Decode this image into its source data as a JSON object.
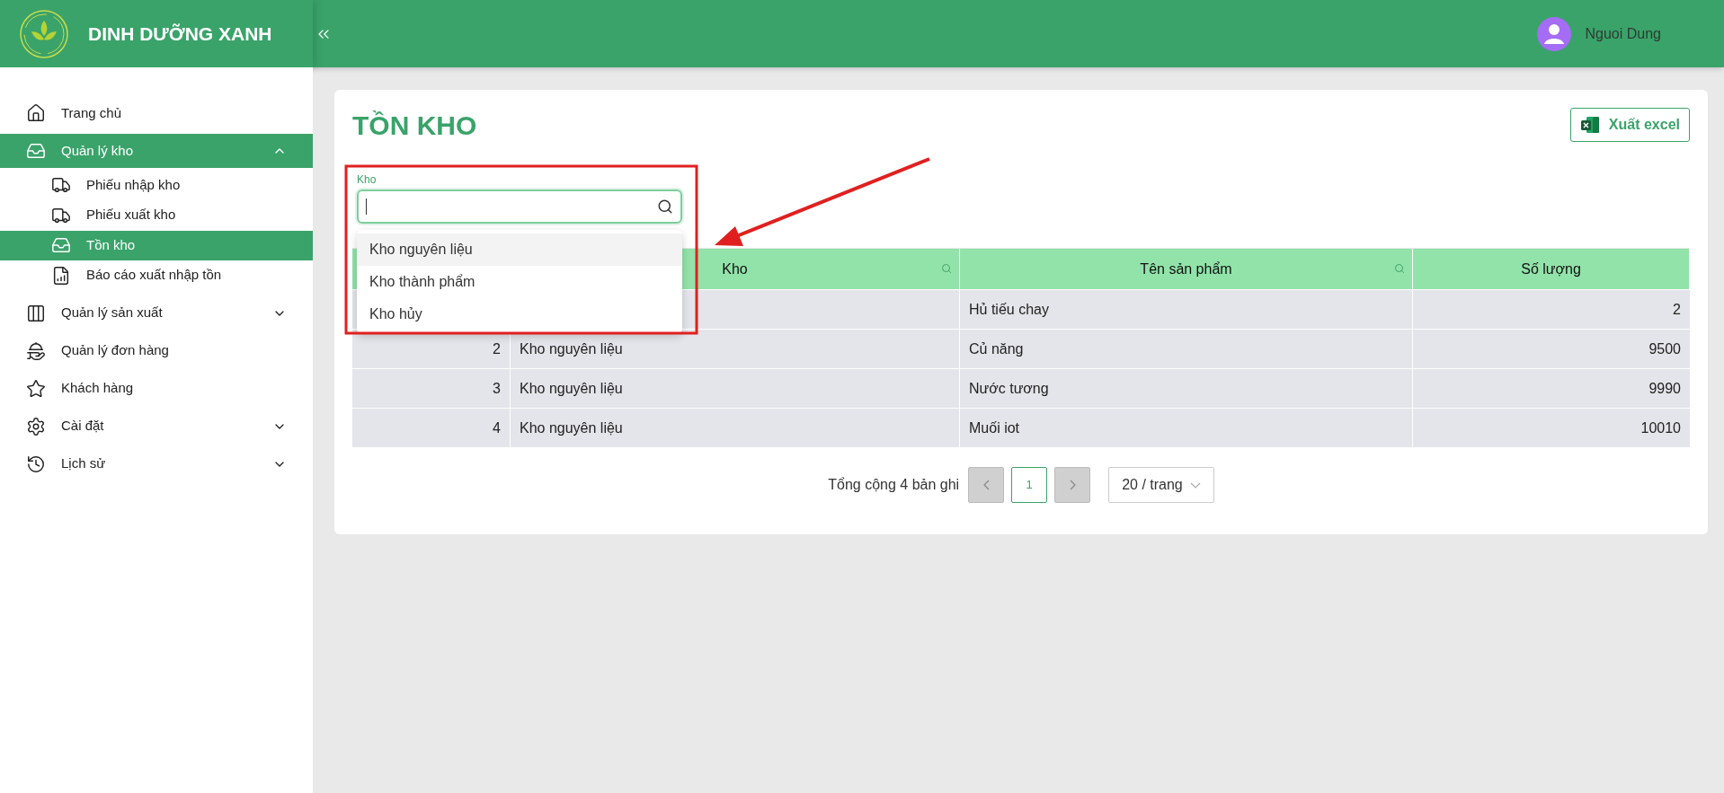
{
  "app": {
    "brand": "DINH DƯỠNG XANH"
  },
  "user": {
    "name": "Nguoi Dung"
  },
  "sidebar": {
    "items": [
      {
        "label": "Trang chủ",
        "selected": false
      },
      {
        "label": "Quản lý kho",
        "selected": true,
        "expanded": true,
        "children": [
          {
            "label": "Phiếu nhập kho",
            "selected": false
          },
          {
            "label": "Phiếu xuất kho",
            "selected": false
          },
          {
            "label": "Tồn kho",
            "selected": true
          },
          {
            "label": "Báo cáo xuất nhập tồn",
            "selected": false
          }
        ]
      },
      {
        "label": "Quản lý sản xuất",
        "selected": false,
        "expanded": false
      },
      {
        "label": "Quản lý đơn hàng",
        "selected": false
      },
      {
        "label": "Khách hàng",
        "selected": false
      },
      {
        "label": "Cài đặt",
        "selected": false,
        "expanded": false
      },
      {
        "label": "Lịch sử",
        "selected": false,
        "expanded": false
      }
    ]
  },
  "page": {
    "title": "TỒN KHO",
    "export_button": "Xuất excel",
    "filter": {
      "label": "Kho",
      "focused": true,
      "options": [
        {
          "label": "Kho nguyên liệu",
          "selected": true
        },
        {
          "label": "Kho thành phẩm",
          "selected": false
        },
        {
          "label": "Kho hủy",
          "selected": false
        }
      ]
    },
    "table": {
      "columns": [
        {
          "label": "Kho",
          "searchable": true
        },
        {
          "label": "Tên sản phẩm",
          "searchable": true
        },
        {
          "label": "Số lượng",
          "searchable": false
        }
      ],
      "rows": [
        {
          "product": "Hủ tiếu chay",
          "quantity": "2"
        },
        {
          "index": "2",
          "warehouse": "Kho nguyên liệu",
          "product": "Củ năng",
          "quantity": "9500"
        },
        {
          "index": "3",
          "warehouse": "Kho nguyên liệu",
          "product": "Nước tương",
          "quantity": "9990"
        },
        {
          "index": "4",
          "warehouse": "Kho nguyên liệu",
          "product": "Muối iot",
          "quantity": "10010"
        }
      ]
    },
    "pagination": {
      "total": "Tổng cộng 4 bản ghi",
      "prev_disabled": true,
      "next_disabled": true,
      "pages": [
        {
          "label": "1",
          "selected": true
        }
      ],
      "page_size": "20 / trang"
    }
  }
}
